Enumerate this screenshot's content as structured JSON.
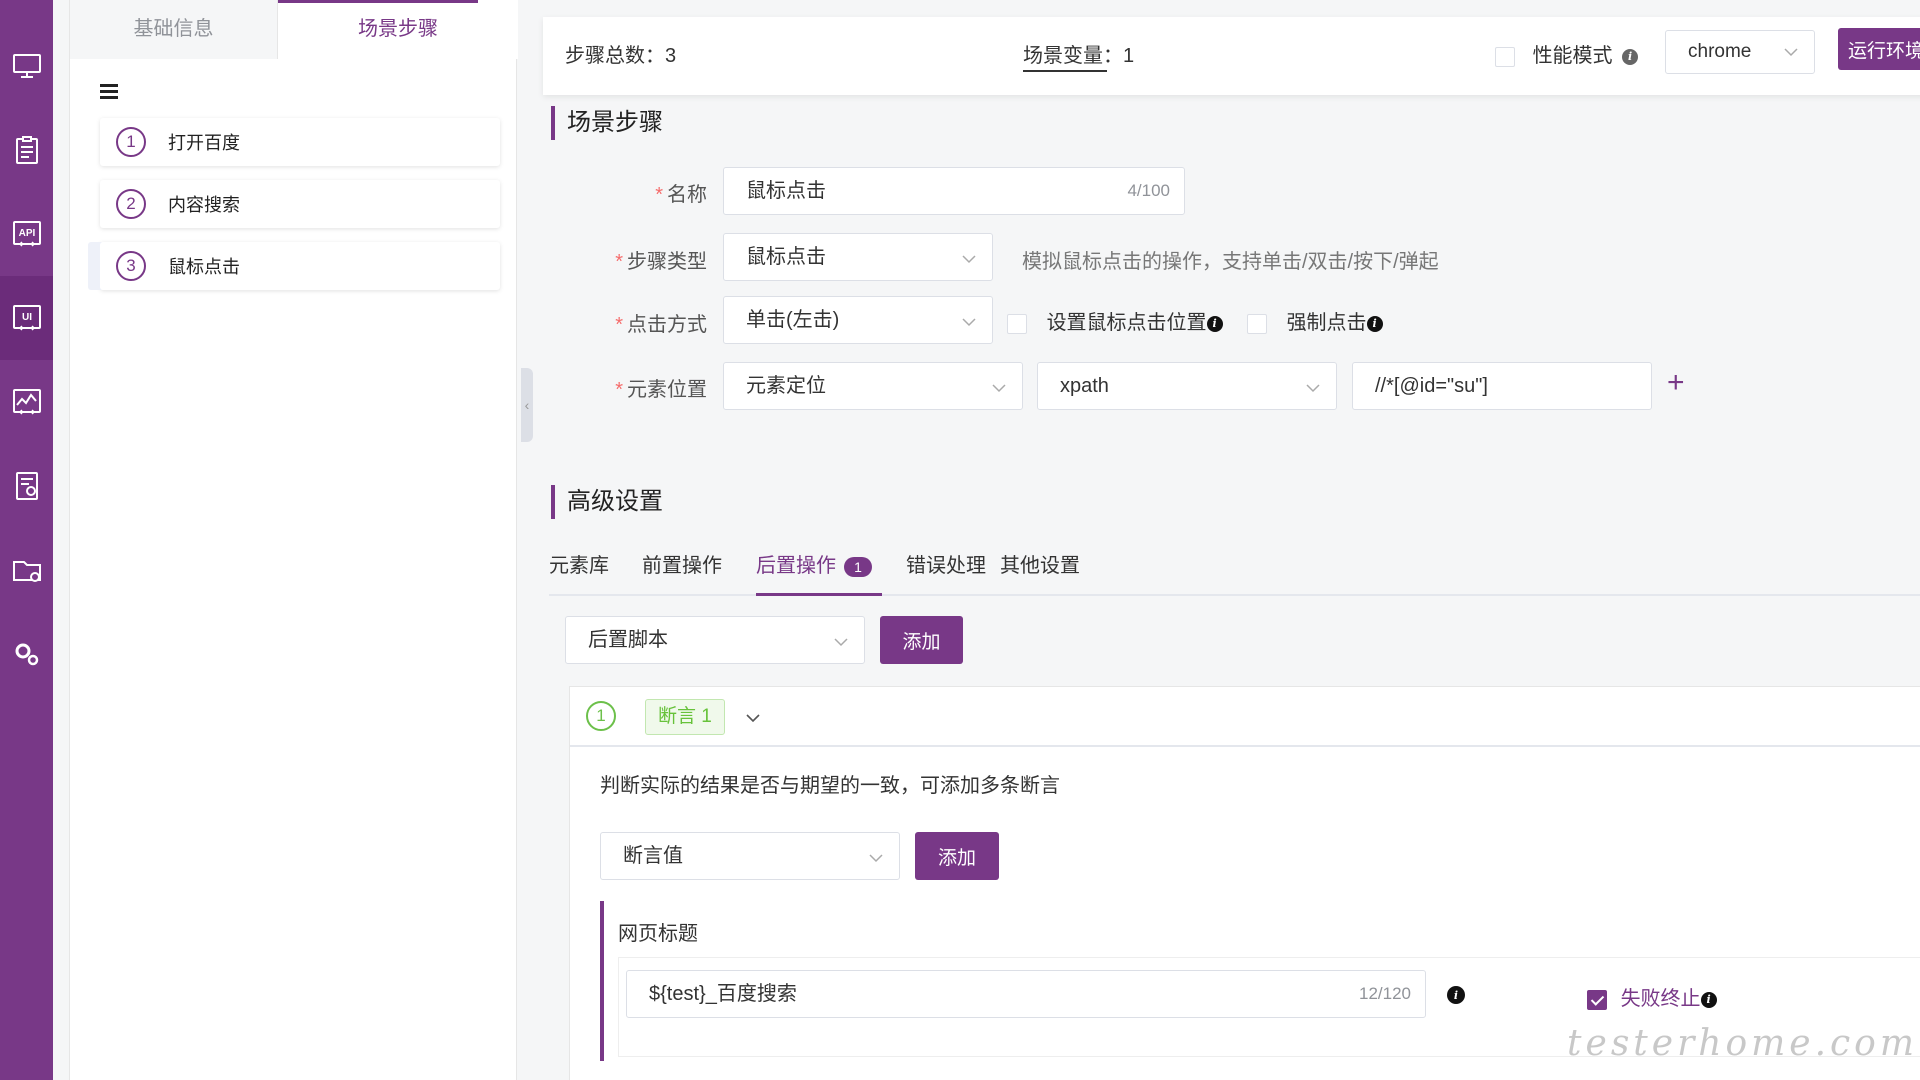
{
  "rail": {
    "icons": [
      "monitor-icon",
      "clipboard-icon",
      "api-icon",
      "ui-icon",
      "performance-icon",
      "report-icon",
      "folder-icon",
      "settings-icon"
    ],
    "active": "ui-icon",
    "labels": {
      "api": "API",
      "ui": "UI"
    }
  },
  "panel": {
    "tabs": [
      {
        "label": "基础信息"
      },
      {
        "label": "场景步骤"
      }
    ],
    "steps": [
      {
        "num": "1",
        "label": "打开百度"
      },
      {
        "num": "2",
        "label": "内容搜索"
      },
      {
        "num": "3",
        "label": "鼠标点击"
      }
    ]
  },
  "topbar": {
    "step_total_label": "步骤总数：",
    "step_total": "3",
    "scene_var_label": "场景变量：",
    "scene_var": "1",
    "perf_mode": "性能模式",
    "browser": "chrome",
    "run_env": "运行环境"
  },
  "scene": {
    "title": "场景步骤",
    "name_label": "名称",
    "name_value": "鼠标点击",
    "name_count": "4/100",
    "type_label": "步骤类型",
    "type_value": "鼠标点击",
    "type_hint": "模拟鼠标点击的操作，支持单击/双击/按下/弹起",
    "click_label": "点击方式",
    "click_value": "单击(左击)",
    "set_position": "设置鼠标点击位置",
    "force_click": "强制点击",
    "elem_label": "元素位置",
    "elem_mode": "元素定位",
    "locator_type": "xpath",
    "locator_value": "//*[@id=\"su\"]"
  },
  "advanced": {
    "title": "高级设置",
    "tabs": [
      {
        "label": "元素库"
      },
      {
        "label": "前置操作"
      },
      {
        "label": "后置操作",
        "badge": "1"
      },
      {
        "label": "错误处理"
      },
      {
        "label": "其他设置"
      }
    ],
    "post_select": "后置脚本",
    "add": "添加"
  },
  "assertion": {
    "num": "1",
    "tag": "断言 1",
    "desc": "判断实际的结果是否与期望的一致，可添加多条断言",
    "type_select": "断言值",
    "add": "添加",
    "sub_title": "网页标题",
    "value": "${test}_百度搜索",
    "count": "12/120",
    "fail_stop": "失败终止",
    "fail_stop_checked": true
  },
  "watermark": "testerhome.com",
  "colors": {
    "primary": "#783887",
    "success": "#67c23a",
    "danger": "#f56c6c"
  }
}
